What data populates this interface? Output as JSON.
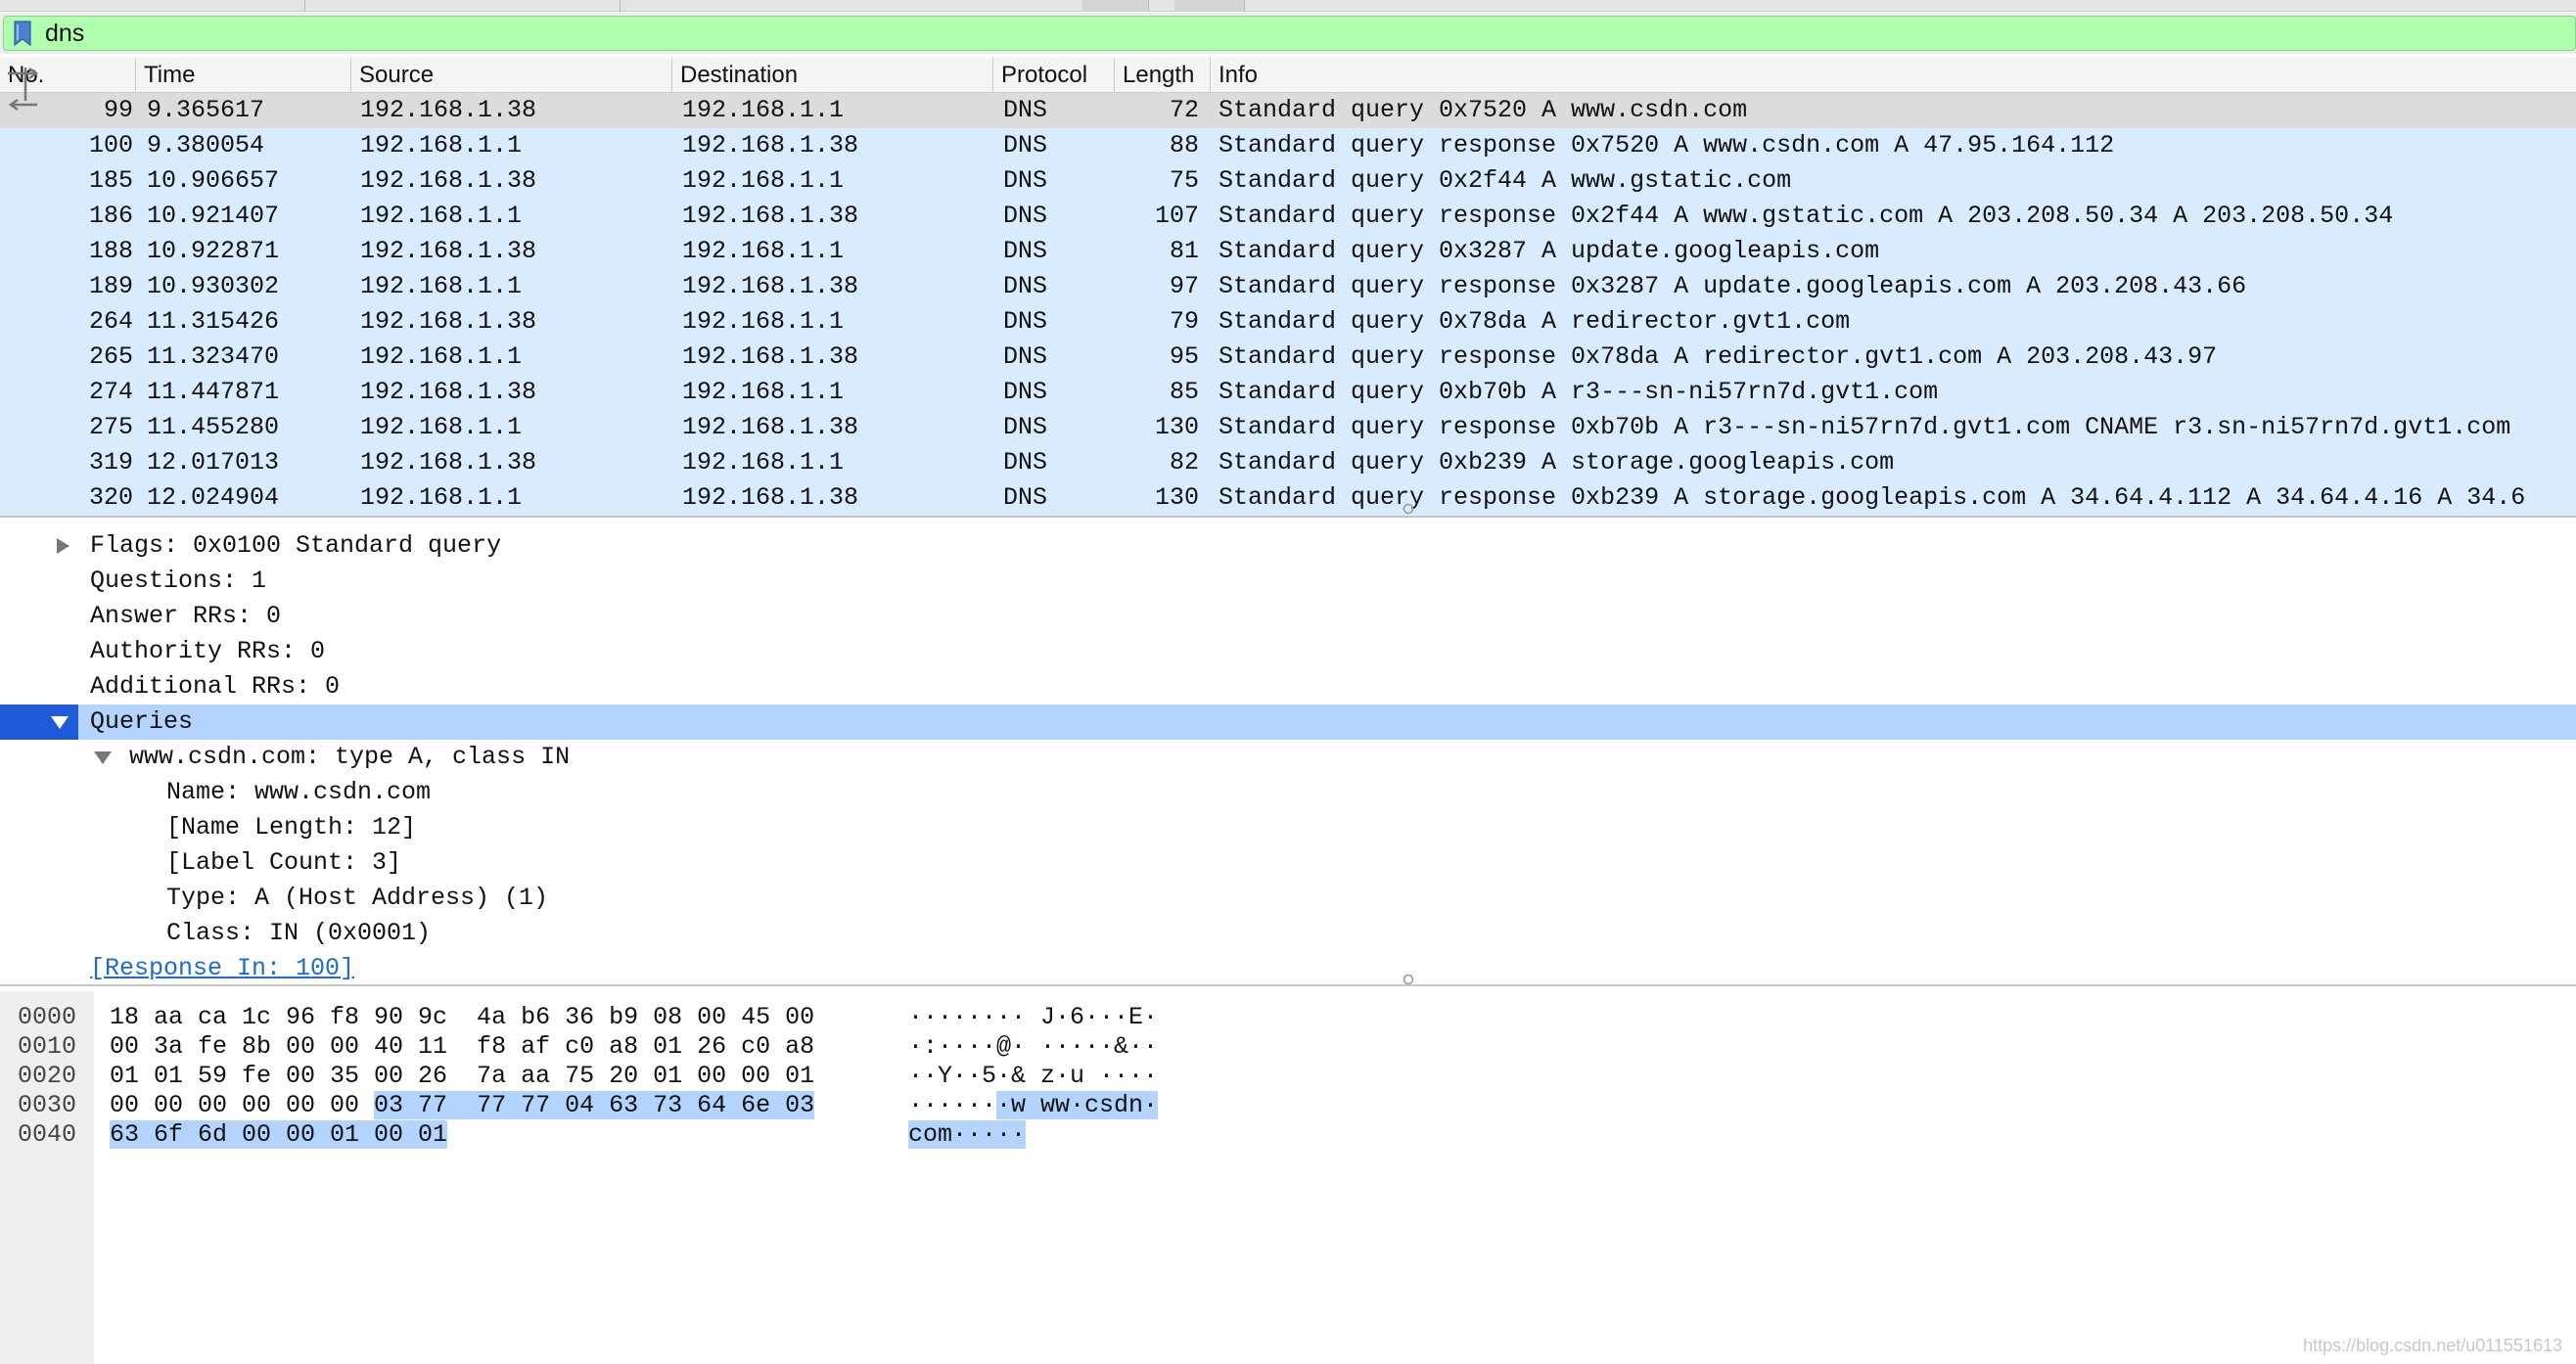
{
  "filter": {
    "value": "dns",
    "bookmark_icon": "bookmark-icon",
    "background_color": "#afffaf"
  },
  "packet_list": {
    "columns": [
      "No.",
      "Time",
      "Source",
      "Destination",
      "Protocol",
      "Length",
      "Info"
    ],
    "selected_row_color": "#dcdcdc",
    "row_color": "#d9ecff",
    "rows": [
      {
        "no": "99",
        "time": "9.365617",
        "src": "192.168.1.38",
        "dst": "192.168.1.1",
        "proto": "DNS",
        "len": "72",
        "info": "Standard query 0x7520 A www.csdn.com"
      },
      {
        "no": "100",
        "time": "9.380054",
        "src": "192.168.1.1",
        "dst": "192.168.1.38",
        "proto": "DNS",
        "len": "88",
        "info": "Standard query response 0x7520 A www.csdn.com A 47.95.164.112"
      },
      {
        "no": "185",
        "time": "10.906657",
        "src": "192.168.1.38",
        "dst": "192.168.1.1",
        "proto": "DNS",
        "len": "75",
        "info": "Standard query 0x2f44 A www.gstatic.com"
      },
      {
        "no": "186",
        "time": "10.921407",
        "src": "192.168.1.1",
        "dst": "192.168.1.38",
        "proto": "DNS",
        "len": "107",
        "info": "Standard query response 0x2f44 A www.gstatic.com A 203.208.50.34 A 203.208.50.34"
      },
      {
        "no": "188",
        "time": "10.922871",
        "src": "192.168.1.38",
        "dst": "192.168.1.1",
        "proto": "DNS",
        "len": "81",
        "info": "Standard query 0x3287 A update.googleapis.com"
      },
      {
        "no": "189",
        "time": "10.930302",
        "src": "192.168.1.1",
        "dst": "192.168.1.38",
        "proto": "DNS",
        "len": "97",
        "info": "Standard query response 0x3287 A update.googleapis.com A 203.208.43.66"
      },
      {
        "no": "264",
        "time": "11.315426",
        "src": "192.168.1.38",
        "dst": "192.168.1.1",
        "proto": "DNS",
        "len": "79",
        "info": "Standard query 0x78da A redirector.gvt1.com"
      },
      {
        "no": "265",
        "time": "11.323470",
        "src": "192.168.1.1",
        "dst": "192.168.1.38",
        "proto": "DNS",
        "len": "95",
        "info": "Standard query response 0x78da A redirector.gvt1.com A 203.208.43.97"
      },
      {
        "no": "274",
        "time": "11.447871",
        "src": "192.168.1.38",
        "dst": "192.168.1.1",
        "proto": "DNS",
        "len": "85",
        "info": "Standard query 0xb70b A r3---sn-ni57rn7d.gvt1.com"
      },
      {
        "no": "275",
        "time": "11.455280",
        "src": "192.168.1.1",
        "dst": "192.168.1.38",
        "proto": "DNS",
        "len": "130",
        "info": "Standard query response 0xb70b A r3---sn-ni57rn7d.gvt1.com CNAME r3.sn-ni57rn7d.gvt1.com"
      },
      {
        "no": "319",
        "time": "12.017013",
        "src": "192.168.1.38",
        "dst": "192.168.1.1",
        "proto": "DNS",
        "len": "82",
        "info": "Standard query 0xb239 A storage.googleapis.com"
      },
      {
        "no": "320",
        "time": "12.024904",
        "src": "192.168.1.1",
        "dst": "192.168.1.38",
        "proto": "DNS",
        "len": "130",
        "info": "Standard query response 0xb239 A storage.googleapis.com A 34.64.4.112 A 34.64.4.16 A 34.6"
      }
    ]
  },
  "details": {
    "rows": [
      {
        "text": "Flags: 0x0100 Standard query",
        "expander": "collapsed"
      },
      {
        "text": "Questions: 1"
      },
      {
        "text": "Answer RRs: 0"
      },
      {
        "text": "Authority RRs: 0"
      },
      {
        "text": "Additional RRs: 0"
      },
      {
        "text": "Queries",
        "expander": "expanded",
        "selected": true
      },
      {
        "text": "www.csdn.com: type A, class IN",
        "expander": "expanded"
      },
      {
        "text": "Name: www.csdn.com"
      },
      {
        "text": "[Name Length: 12]"
      },
      {
        "text": "[Label Count: 3]"
      },
      {
        "text": "Type: A (Host Address) (1)"
      },
      {
        "text": "Class: IN (0x0001)"
      },
      {
        "text": "[Response In: 100]",
        "link": true
      }
    ],
    "selected_color": "#b3d4ff",
    "link_color": "#1a6bd6"
  },
  "bytes": {
    "rows": [
      {
        "offset": "0000",
        "hex_plain": "18 aa ca 1c 96 f8 90 9c  4a b6 36 b9 08 00 45 00",
        "hex_hl": "",
        "ascii_plain": "········ J·6···E·",
        "ascii_hl": ""
      },
      {
        "offset": "0010",
        "hex_plain": "00 3a fe 8b 00 00 40 11  f8 af c0 a8 01 26 c0 a8",
        "hex_hl": "",
        "ascii_plain": "·:····@· ·····&··",
        "ascii_hl": ""
      },
      {
        "offset": "0020",
        "hex_plain": "01 01 59 fe 00 35 00 26  7a aa 75 20 01 00 00 01",
        "hex_hl": "",
        "ascii_plain": "··Y··5·& z·u ····",
        "ascii_hl": ""
      },
      {
        "offset": "0030",
        "hex_plain": "00 00 00 00 00 00 ",
        "hex_hl": "03 77  77 77 04 63 73 64 6e 03",
        "ascii_plain": "······",
        "ascii_hl": "·w ww·csdn·"
      },
      {
        "offset": "0040",
        "hex_plain": "",
        "hex_hl": "63 6f 6d 00 00 01 00 01",
        "ascii_plain": "",
        "ascii_hl": "com·····"
      }
    ],
    "highlight_color": "#b3d4ff"
  },
  "watermark": "https://blog.csdn.net/u011551613"
}
